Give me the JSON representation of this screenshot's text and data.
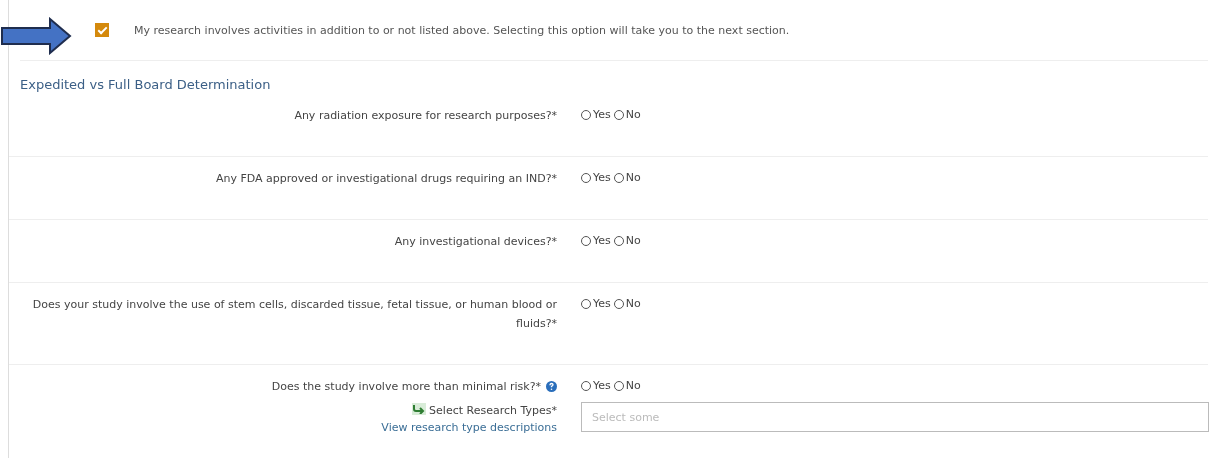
{
  "option": {
    "checked": true,
    "label": "My research involves activities in addition to or not listed above. Selecting this option will take you to the next section."
  },
  "section_title": "Expedited vs Full Board Determination",
  "questions": [
    {
      "label": "Any radiation exposure for research purposes?*",
      "help": false,
      "options": [
        {
          "label": "Yes",
          "selected": false
        },
        {
          "label": "No",
          "selected": false
        }
      ]
    },
    {
      "label": "Any FDA approved or investigational drugs requiring an IND?*",
      "help": false,
      "options": [
        {
          "label": "Yes",
          "selected": false
        },
        {
          "label": "No",
          "selected": false
        }
      ]
    },
    {
      "label": "Any investigational devices?*",
      "help": false,
      "options": [
        {
          "label": "Yes",
          "selected": false
        },
        {
          "label": "No",
          "selected": false
        }
      ]
    },
    {
      "label": "Does your study involve the use of stem cells, discarded tissue, fetal tissue, or human blood or fluids?*",
      "help": false,
      "options": [
        {
          "label": "Yes",
          "selected": false
        },
        {
          "label": "No",
          "selected": false
        }
      ]
    },
    {
      "label": "Does the study involve more than minimal risk?*",
      "help": true,
      "options": [
        {
          "label": "Yes",
          "selected": false
        },
        {
          "label": "No",
          "selected": false
        }
      ]
    }
  ],
  "research_types": {
    "label": "Select Research Types*",
    "link": "View research type descriptions",
    "placeholder": "Select some"
  }
}
